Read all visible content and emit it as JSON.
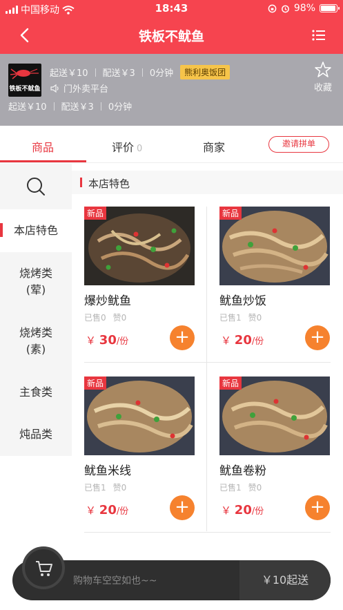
{
  "status_bar": {
    "carrier": "中国移动",
    "time": "18:43",
    "battery": "98%"
  },
  "header": {
    "title": "铁板不鱿鱼"
  },
  "shop": {
    "logo_text": "铁板不鱿鱼",
    "min_order": "起送￥10",
    "delivery_fee": "配送￥3",
    "delivery_time": "0分钟",
    "group_badge": "熊利奥饭团",
    "announcement": "门外卖平台",
    "min_order_2": "起送￥10",
    "delivery_fee_2": "配送￥3",
    "delivery_time_2": "0分钟",
    "favorite_label": "收藏"
  },
  "tabs": {
    "products": "商品",
    "reviews": "评价",
    "reviews_count": "0",
    "merchant": "商家",
    "invite": "邀请拼单"
  },
  "sidebar": {
    "categories": [
      {
        "label": "本店特色"
      },
      {
        "label": "烧烤类",
        "sub": "(荤)"
      },
      {
        "label": "烧烤类",
        "sub": "(素)"
      },
      {
        "label": "主食类"
      },
      {
        "label": "炖品类"
      }
    ]
  },
  "section": {
    "title": "本店特色"
  },
  "products": [
    {
      "tag": "新品",
      "name": "爆炒鱿鱼",
      "sold": "已售0",
      "likes": "赞0",
      "currency": "￥",
      "price": "30",
      "unit": "/份"
    },
    {
      "tag": "新品",
      "name": "鱿鱼炒饭",
      "sold": "已售1",
      "likes": "赞0",
      "currency": "￥",
      "price": "20",
      "unit": "/份"
    },
    {
      "tag": "新品",
      "name": "鱿鱼米线",
      "sold": "已售1",
      "likes": "赞0",
      "currency": "￥",
      "price": "20",
      "unit": "/份"
    },
    {
      "tag": "新品",
      "name": "鱿鱼卷粉",
      "sold": "已售1",
      "likes": "赞0",
      "currency": "￥",
      "price": "20",
      "unit": "/份"
    }
  ],
  "cart": {
    "empty_text": "购物车空空如也~~",
    "min_order_button": "￥10起送"
  },
  "colors": {
    "brand_red": "#f6444f",
    "accent_orange": "#f6822e",
    "badge_yellow": "#f6c44a"
  }
}
